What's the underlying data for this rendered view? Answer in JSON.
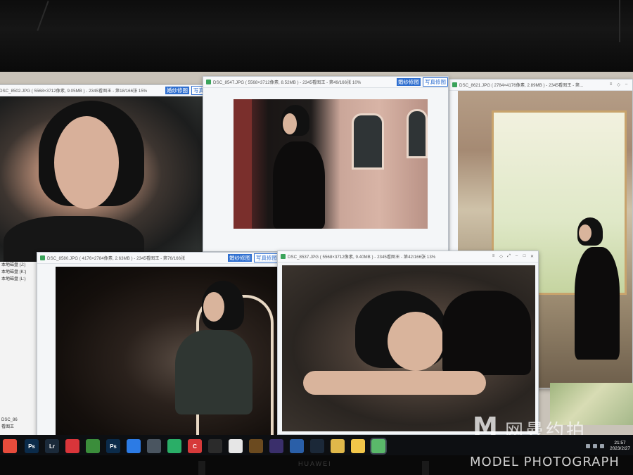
{
  "monitor": {
    "brand": "HUAWEI"
  },
  "windows": [
    {
      "id": "w1",
      "title": "DSC_8502.JPG ( 5568×3712像素, 9.05MB ) - 2345看图王 - 第18/166张 15%",
      "badge_primary": "婚纱修图",
      "badge_secondary": "写真"
    },
    {
      "id": "w2",
      "title": "DSC_8547.JPG ( 5568×3712像素, 8.52MB ) - 2345看图王 - 第49/166张 10%",
      "badge_primary": "婚纱修图",
      "badge_secondary": "写真修图"
    },
    {
      "id": "w3",
      "title": "DSC_8621.JPG ( 2784×4176像素, 2.89MB ) - 2345看图王 - 第...",
      "badge_primary": "",
      "badge_secondary": ""
    },
    {
      "id": "w4",
      "title": "DSC_8580.JPG ( 4176×2784像素, 2.63MB ) - 2345看图王 - 第76/166张",
      "badge_primary": "婚纱修图",
      "badge_secondary": "写真修图"
    },
    {
      "id": "w5",
      "title": "DSC_8537.JPG ( 5568×3712像素, 9.40MB ) - 2345看图王 - 第42/166张 13%",
      "badge_primary": "",
      "badge_secondary": ""
    }
  ],
  "left_pane": {
    "drives": [
      "本地磁盘 (J:)",
      "本地磁盘 (K:)",
      "本地磁盘 (L:)"
    ],
    "bottom_items": [
      "DSC_86",
      "看图王"
    ]
  },
  "taskbar": {
    "apps": [
      {
        "name": "chrome-colorful",
        "label": "",
        "color": "#e74c3c"
      },
      {
        "name": "photoshop",
        "label": "Ps",
        "color": "#0b2b4a"
      },
      {
        "name": "lightroom",
        "label": "Lr",
        "color": "#1b2a3a"
      },
      {
        "name": "netease-music",
        "label": "",
        "color": "#d9353a"
      },
      {
        "name": "chrome",
        "label": "",
        "color": "#3b8d3b"
      },
      {
        "name": "photoshop-2",
        "label": "Ps",
        "color": "#0b2b4a"
      },
      {
        "name": "feishu",
        "label": "",
        "color": "#2c7be5"
      },
      {
        "name": "app-grey",
        "label": "",
        "color": "#4a5560"
      },
      {
        "name": "wechat",
        "label": "",
        "color": "#2aae67"
      },
      {
        "name": "app-red",
        "label": "C",
        "color": "#d63a3a"
      },
      {
        "name": "portrait-app",
        "label": "",
        "color": "#2b2b2b"
      },
      {
        "name": "file",
        "label": "",
        "color": "#e6e6e6"
      },
      {
        "name": "game-1",
        "label": "",
        "color": "#6b4a1f"
      },
      {
        "name": "game-2",
        "label": "",
        "color": "#3a2f6b"
      },
      {
        "name": "browser-blue",
        "label": "",
        "color": "#2a5fa8"
      },
      {
        "name": "steam",
        "label": "",
        "color": "#1b2838"
      },
      {
        "name": "folder",
        "label": "",
        "color": "#e0b84a"
      },
      {
        "name": "explorer",
        "label": "",
        "color": "#f2c649"
      },
      {
        "name": "image-viewer",
        "label": "",
        "color": "#5ab86a"
      }
    ],
    "clock_time": "21:57",
    "clock_date": "2023/2/27"
  },
  "watermark": {
    "logo_letter": "M",
    "logo_text": "网曼约拍",
    "caption": "MODEL PHOTOGRAPH"
  }
}
